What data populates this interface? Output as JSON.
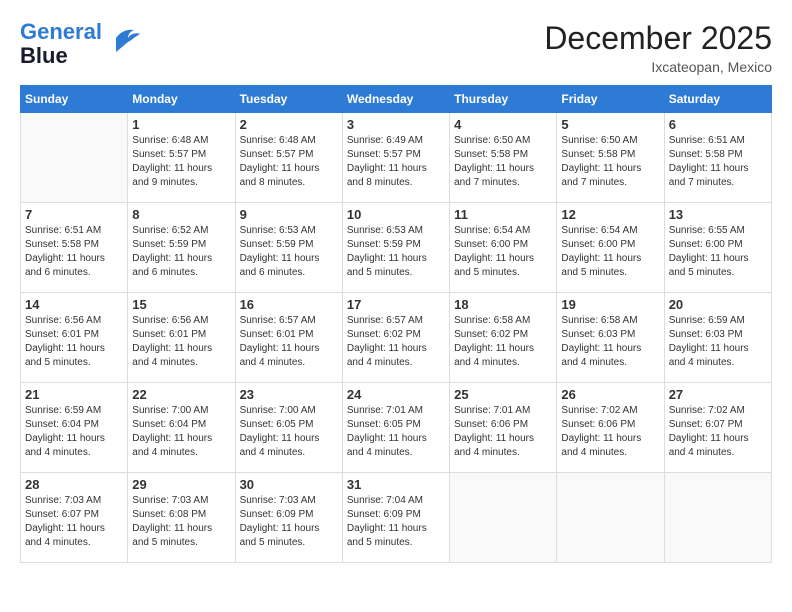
{
  "logo": {
    "line1": "General",
    "line2": "Blue"
  },
  "title": "December 2025",
  "location": "Ixcateopan, Mexico",
  "days_of_week": [
    "Sunday",
    "Monday",
    "Tuesday",
    "Wednesday",
    "Thursday",
    "Friday",
    "Saturday"
  ],
  "weeks": [
    [
      {
        "day": "",
        "info": ""
      },
      {
        "day": "1",
        "info": "Sunrise: 6:48 AM\nSunset: 5:57 PM\nDaylight: 11 hours\nand 9 minutes."
      },
      {
        "day": "2",
        "info": "Sunrise: 6:48 AM\nSunset: 5:57 PM\nDaylight: 11 hours\nand 8 minutes."
      },
      {
        "day": "3",
        "info": "Sunrise: 6:49 AM\nSunset: 5:57 PM\nDaylight: 11 hours\nand 8 minutes."
      },
      {
        "day": "4",
        "info": "Sunrise: 6:50 AM\nSunset: 5:58 PM\nDaylight: 11 hours\nand 7 minutes."
      },
      {
        "day": "5",
        "info": "Sunrise: 6:50 AM\nSunset: 5:58 PM\nDaylight: 11 hours\nand 7 minutes."
      },
      {
        "day": "6",
        "info": "Sunrise: 6:51 AM\nSunset: 5:58 PM\nDaylight: 11 hours\nand 7 minutes."
      }
    ],
    [
      {
        "day": "7",
        "info": "Sunrise: 6:51 AM\nSunset: 5:58 PM\nDaylight: 11 hours\nand 6 minutes."
      },
      {
        "day": "8",
        "info": "Sunrise: 6:52 AM\nSunset: 5:59 PM\nDaylight: 11 hours\nand 6 minutes."
      },
      {
        "day": "9",
        "info": "Sunrise: 6:53 AM\nSunset: 5:59 PM\nDaylight: 11 hours\nand 6 minutes."
      },
      {
        "day": "10",
        "info": "Sunrise: 6:53 AM\nSunset: 5:59 PM\nDaylight: 11 hours\nand 5 minutes."
      },
      {
        "day": "11",
        "info": "Sunrise: 6:54 AM\nSunset: 6:00 PM\nDaylight: 11 hours\nand 5 minutes."
      },
      {
        "day": "12",
        "info": "Sunrise: 6:54 AM\nSunset: 6:00 PM\nDaylight: 11 hours\nand 5 minutes."
      },
      {
        "day": "13",
        "info": "Sunrise: 6:55 AM\nSunset: 6:00 PM\nDaylight: 11 hours\nand 5 minutes."
      }
    ],
    [
      {
        "day": "14",
        "info": "Sunrise: 6:56 AM\nSunset: 6:01 PM\nDaylight: 11 hours\nand 5 minutes."
      },
      {
        "day": "15",
        "info": "Sunrise: 6:56 AM\nSunset: 6:01 PM\nDaylight: 11 hours\nand 4 minutes."
      },
      {
        "day": "16",
        "info": "Sunrise: 6:57 AM\nSunset: 6:01 PM\nDaylight: 11 hours\nand 4 minutes."
      },
      {
        "day": "17",
        "info": "Sunrise: 6:57 AM\nSunset: 6:02 PM\nDaylight: 11 hours\nand 4 minutes."
      },
      {
        "day": "18",
        "info": "Sunrise: 6:58 AM\nSunset: 6:02 PM\nDaylight: 11 hours\nand 4 minutes."
      },
      {
        "day": "19",
        "info": "Sunrise: 6:58 AM\nSunset: 6:03 PM\nDaylight: 11 hours\nand 4 minutes."
      },
      {
        "day": "20",
        "info": "Sunrise: 6:59 AM\nSunset: 6:03 PM\nDaylight: 11 hours\nand 4 minutes."
      }
    ],
    [
      {
        "day": "21",
        "info": "Sunrise: 6:59 AM\nSunset: 6:04 PM\nDaylight: 11 hours\nand 4 minutes."
      },
      {
        "day": "22",
        "info": "Sunrise: 7:00 AM\nSunset: 6:04 PM\nDaylight: 11 hours\nand 4 minutes."
      },
      {
        "day": "23",
        "info": "Sunrise: 7:00 AM\nSunset: 6:05 PM\nDaylight: 11 hours\nand 4 minutes."
      },
      {
        "day": "24",
        "info": "Sunrise: 7:01 AM\nSunset: 6:05 PM\nDaylight: 11 hours\nand 4 minutes."
      },
      {
        "day": "25",
        "info": "Sunrise: 7:01 AM\nSunset: 6:06 PM\nDaylight: 11 hours\nand 4 minutes."
      },
      {
        "day": "26",
        "info": "Sunrise: 7:02 AM\nSunset: 6:06 PM\nDaylight: 11 hours\nand 4 minutes."
      },
      {
        "day": "27",
        "info": "Sunrise: 7:02 AM\nSunset: 6:07 PM\nDaylight: 11 hours\nand 4 minutes."
      }
    ],
    [
      {
        "day": "28",
        "info": "Sunrise: 7:03 AM\nSunset: 6:07 PM\nDaylight: 11 hours\nand 4 minutes."
      },
      {
        "day": "29",
        "info": "Sunrise: 7:03 AM\nSunset: 6:08 PM\nDaylight: 11 hours\nand 5 minutes."
      },
      {
        "day": "30",
        "info": "Sunrise: 7:03 AM\nSunset: 6:09 PM\nDaylight: 11 hours\nand 5 minutes."
      },
      {
        "day": "31",
        "info": "Sunrise: 7:04 AM\nSunset: 6:09 PM\nDaylight: 11 hours\nand 5 minutes."
      },
      {
        "day": "",
        "info": ""
      },
      {
        "day": "",
        "info": ""
      },
      {
        "day": "",
        "info": ""
      }
    ]
  ]
}
